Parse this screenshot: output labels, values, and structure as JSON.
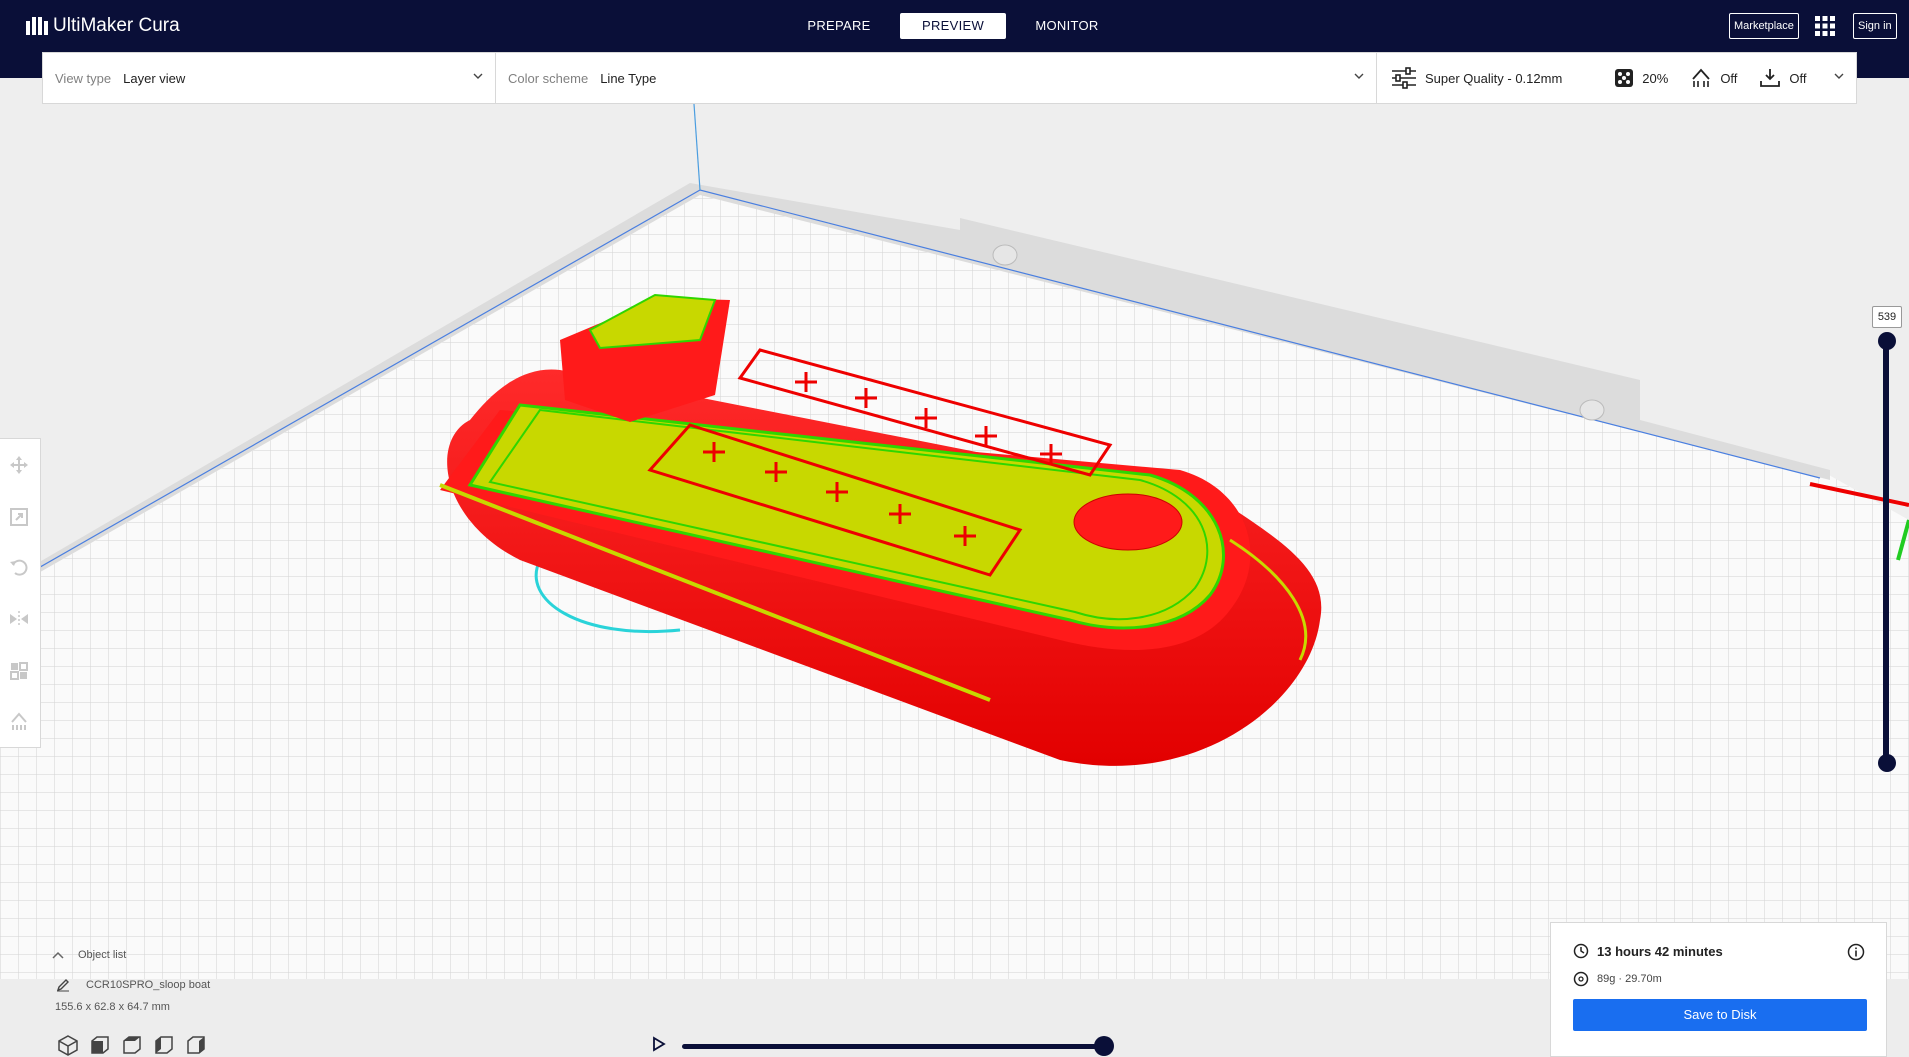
{
  "header": {
    "logo_text": "UltiMaker Cura",
    "stages": [
      "PREPARE",
      "PREVIEW",
      "MONITOR"
    ],
    "active_stage": "PREVIEW",
    "marketplace_label": "Marketplace",
    "signin_label": "Sign in"
  },
  "toolbar": {
    "view_type_label": "View type",
    "view_type_value": "Layer view",
    "color_scheme_label": "Color scheme",
    "color_scheme_value": "Line Type",
    "profile": "Super Quality - 0.12mm",
    "infill": "20%",
    "support": "Off",
    "adhesion": "Off"
  },
  "layer_slider": {
    "current_layer": "539"
  },
  "object_list": {
    "title": "Object list",
    "object_name": "CCR10SPRO_sloop boat",
    "dimensions": "155.6 x 62.8 x 64.7 mm"
  },
  "action_panel": {
    "print_time": "13 hours 42 minutes",
    "material": "89g · 29.70m",
    "save_label": "Save to Disk"
  },
  "colors": {
    "header_bg": "#0a0f38",
    "accent": "#196ef0",
    "model_wall": "#ff1a1a",
    "model_infill": "#c8d800",
    "model_skin": "#2fd600",
    "travel": "#2ad3d9"
  },
  "icons": {
    "tools": [
      "move-icon",
      "scale-icon",
      "rotate-icon",
      "mirror-icon",
      "per-model-settings-icon",
      "support-blocker-icon"
    ],
    "views": [
      "view-3d-icon",
      "view-front-icon",
      "view-top-icon",
      "view-left-icon",
      "view-right-icon"
    ]
  }
}
